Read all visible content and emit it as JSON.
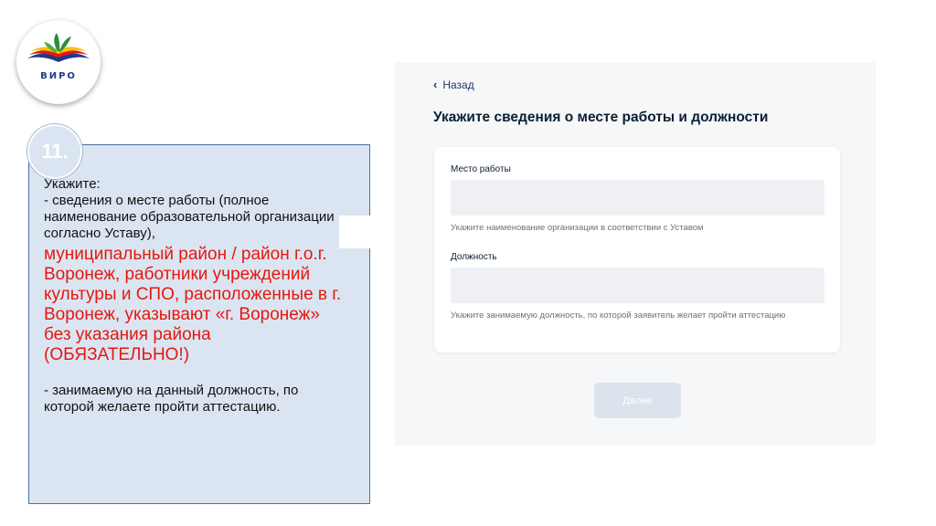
{
  "logo": {
    "text": "ВИРО"
  },
  "instruction": {
    "step": "11.",
    "intro": "Укажите:",
    "item1": "- сведения о месте работы (полное наименование образовательной организации согласно Уставу),",
    "note": "муниципальный район / район г.о.г. Воронеж, работники учреждений культуры и СПО, расположенные в г. Воронеж, указывают «г. Воронеж» без указания района (ОБЯЗАТЕЛЬНО!)",
    "item2": "- занимаемую на данный должность, по которой желаете пройти аттестацию."
  },
  "form": {
    "back_label": "Назад",
    "title": "Укажите сведения о месте работы и должности",
    "fields": [
      {
        "label": "Место работы",
        "value": "",
        "hint": "Укажите наименование организации в соответствии с Уставом"
      },
      {
        "label": "Должность",
        "value": "",
        "hint": "Укажите занимаемую должность, по которой заявитель желает пройти аттестацию"
      }
    ],
    "next_label": "Далее"
  },
  "colors": {
    "note_red": "#e5170f",
    "panel_bg": "#dbe5f1",
    "panel_border": "#4a6fa5",
    "heading": "#0b1f33"
  }
}
